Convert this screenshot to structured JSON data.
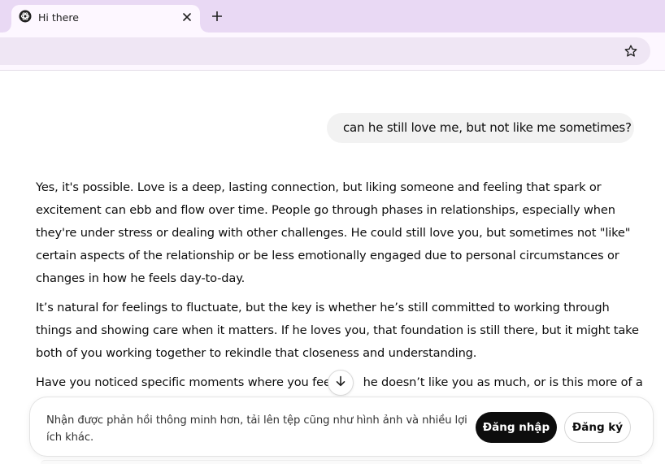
{
  "browser": {
    "tab_title": "Hi there",
    "tab_favicon": "chatgpt-logo-icon",
    "close_icon": "close-icon",
    "new_tab_icon": "plus-icon",
    "bookmark_icon": "star-icon",
    "colors": {
      "tabstrip": "#e9d9f4",
      "active_tab": "#fdf7ff",
      "omnibox": "#efe6f4"
    }
  },
  "chat": {
    "user_message": "can he still love me, but not like me sometimes?",
    "assistant_paragraphs": [
      [
        "Yes, it's possible. Love is a deep, lasting connection, but liking someone and feeling that spark or",
        "excitement can ebb and flow over time. People go through phases in relationships, especially when",
        "they're under stress or dealing with other challenges. He could still love you, but sometimes not \"like\"",
        "certain aspects of the relationship or be less emotionally engaged due to personal circumstances or",
        "changes in how he feels day-to-day."
      ],
      [
        "It’s natural for feelings to fluctuate, but the key is whether he’s still committed to working through",
        "things and showing care when it matters. If he loves you, that foundation is still there, but it might take",
        "both of you working together to rekindle that closeness and understanding."
      ],
      [
        "Have you noticed specific moments where you feel        he doesn’t like you as much, or is this more of a"
      ]
    ],
    "scroll_icon": "arrow-down-icon"
  },
  "banner": {
    "text_line1": "Nhận được phản hồi thông minh hơn, tải lên tệp cũng như hình ảnh và nhiều lợi",
    "text_line2": "ích khác.",
    "login_label": "Đăng nhập",
    "signup_label": "Đăng ký"
  }
}
